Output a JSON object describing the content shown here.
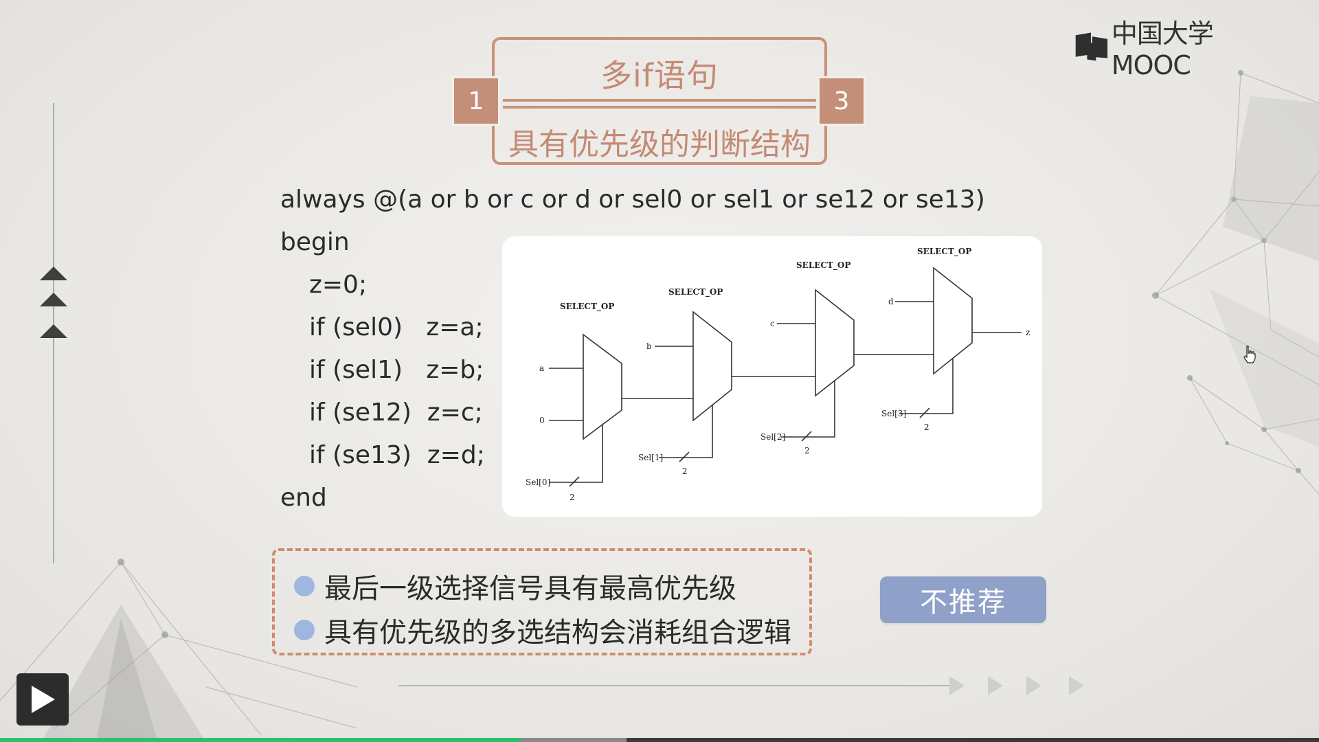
{
  "brand": {
    "logo_text": "中国大学MOOC"
  },
  "title_panel": {
    "top_text": "多if语句",
    "bottom_text": "具有优先级的判断结构",
    "left_number": "1",
    "right_number": "3",
    "accent_color": "#c48f79"
  },
  "code": {
    "lines": [
      "always @(a or b or c or d or sel0 or sel1 or se12 or se13)",
      "begin",
      "z=0;",
      "if (sel0)   z=a;",
      "if (sel1)   z=b;",
      "if (se12)  z=c;",
      "if (se13)  z=d;",
      "end"
    ]
  },
  "diagram": {
    "mux_label": "SELECT_OP",
    "mux1": {
      "in_top": "a",
      "in_bottom": "0",
      "sel": "Sel[0]",
      "width": "2"
    },
    "mux2": {
      "in_top": "b",
      "sel": "Sel[1]",
      "width": "2"
    },
    "mux3": {
      "in_top": "c",
      "sel": "Sel[2]",
      "width": "2"
    },
    "mux4": {
      "in_top": "d",
      "sel": "Sel[3]",
      "width": "2",
      "out": "z"
    }
  },
  "notes": {
    "items": [
      "最后一级选择信号具有最高优先级",
      "具有优先级的多选结构会消耗组合逻辑"
    ],
    "border_color": "#cf8b70",
    "bullet_color": "#9fb6e0"
  },
  "badge": {
    "label": "不推荐",
    "color": "#8fa1c8"
  },
  "player": {
    "play_icon": "play-icon",
    "progress_fraction": 0.395,
    "buffer_fraction": 0.475,
    "progress_color": "#2fbf6f"
  }
}
